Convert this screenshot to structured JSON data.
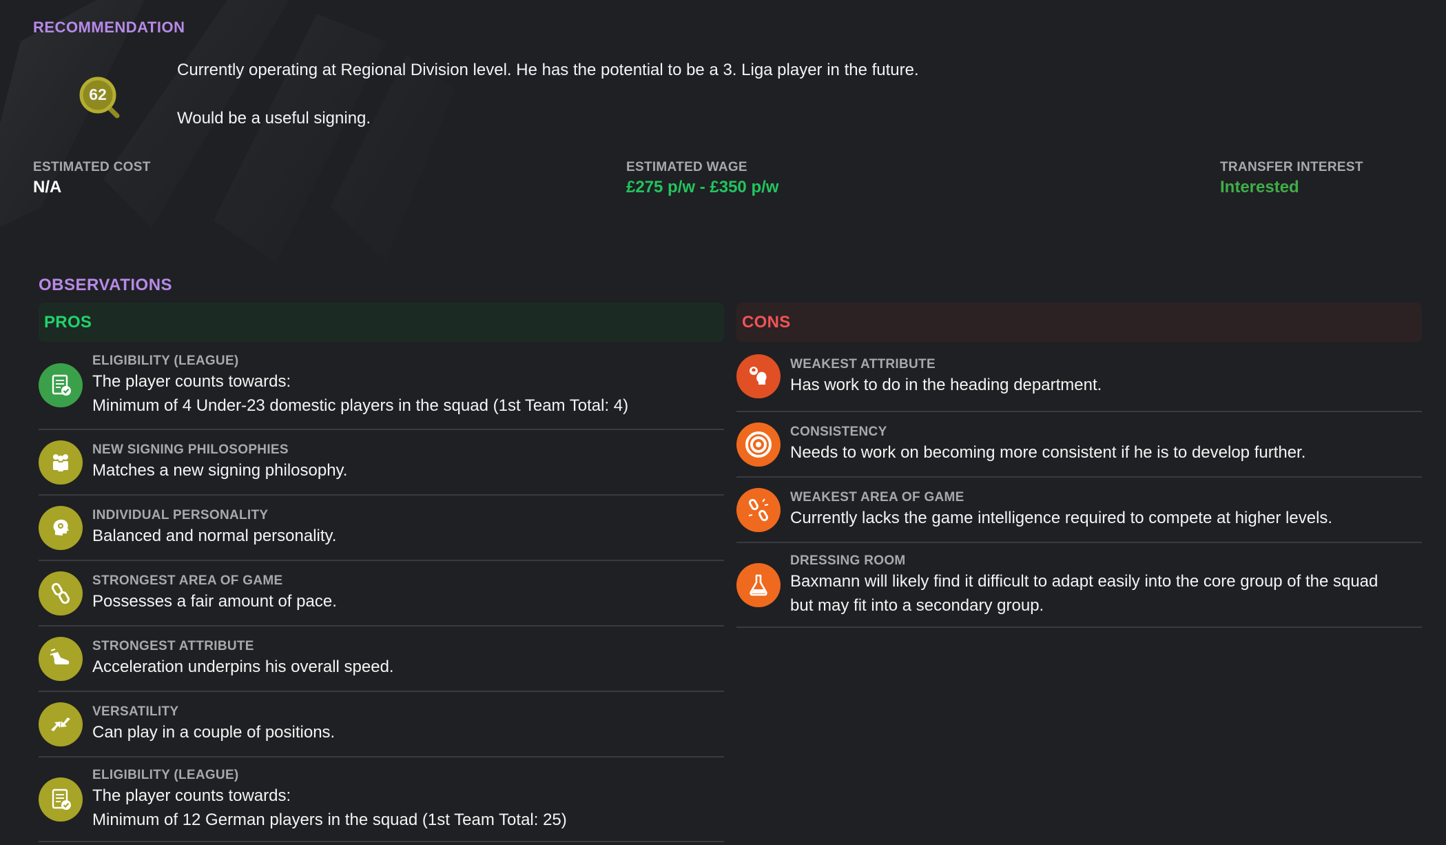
{
  "recommendation": {
    "title": "RECOMMENDATION",
    "rating": "62",
    "line1": "Currently operating at Regional Division level. He has the potential to be a 3. Liga player in the future.",
    "line2": "Would be a useful signing."
  },
  "stats": {
    "cost": {
      "label": "ESTIMATED COST",
      "value": "N/A",
      "color": "#ffffff"
    },
    "wage": {
      "label": "ESTIMATED WAGE",
      "value": "£275 p/w - £350 p/w",
      "color": "#22c55e"
    },
    "interest": {
      "label": "TRANSFER INTEREST",
      "value": "Interested",
      "color": "#3fae49"
    }
  },
  "observations": {
    "title": "OBSERVATIONS",
    "pros": {
      "heading": "PROS",
      "items": [
        {
          "label": "ELIGIBILITY (LEAGUE)",
          "desc1": "The player counts towards:",
          "desc2": "Minimum of 4 Under-23 domestic players in the squad (1st Team Total: 4)",
          "icon": "checklist-icon"
        },
        {
          "label": "NEW SIGNING PHILOSOPHIES",
          "desc1": "Matches a new signing philosophy.",
          "icon": "group-icon"
        },
        {
          "label": "INDIVIDUAL PERSONALITY",
          "desc1": "Balanced and normal personality.",
          "icon": "head-icon"
        },
        {
          "label": "STRONGEST AREA OF GAME",
          "desc1": "Possesses a fair amount of pace.",
          "icon": "chain-icon"
        },
        {
          "label": "STRONGEST ATTRIBUTE",
          "desc1": "Acceleration underpins his overall speed.",
          "icon": "boot-icon"
        },
        {
          "label": "VERSATILITY",
          "desc1": "Can play in a couple of positions.",
          "icon": "arrows-icon"
        },
        {
          "label": "ELIGIBILITY (LEAGUE)",
          "desc1": "The player counts towards:",
          "desc2": "Minimum of 12 German players in the squad (1st Team Total: 25)",
          "icon": "checklist-icon"
        }
      ]
    },
    "cons": {
      "heading": "CONS",
      "items": [
        {
          "label": "WEAKEST ATTRIBUTE",
          "desc1": "Has work to do in the heading department.",
          "icon": "heading-icon"
        },
        {
          "label": "CONSISTENCY",
          "desc1": "Needs to work on becoming more consistent if he is to develop further.",
          "icon": "target-icon"
        },
        {
          "label": "WEAKEST AREA OF GAME",
          "desc1": "Currently lacks the game intelligence required to compete at higher levels.",
          "icon": "broken-chain-icon"
        },
        {
          "label": "DRESSING ROOM",
          "desc1": "Baxmann will likely find it difficult to adapt easily into the core group of the squad",
          "desc2": "but may fit into a secondary group.",
          "icon": "flask-icon"
        }
      ]
    }
  }
}
